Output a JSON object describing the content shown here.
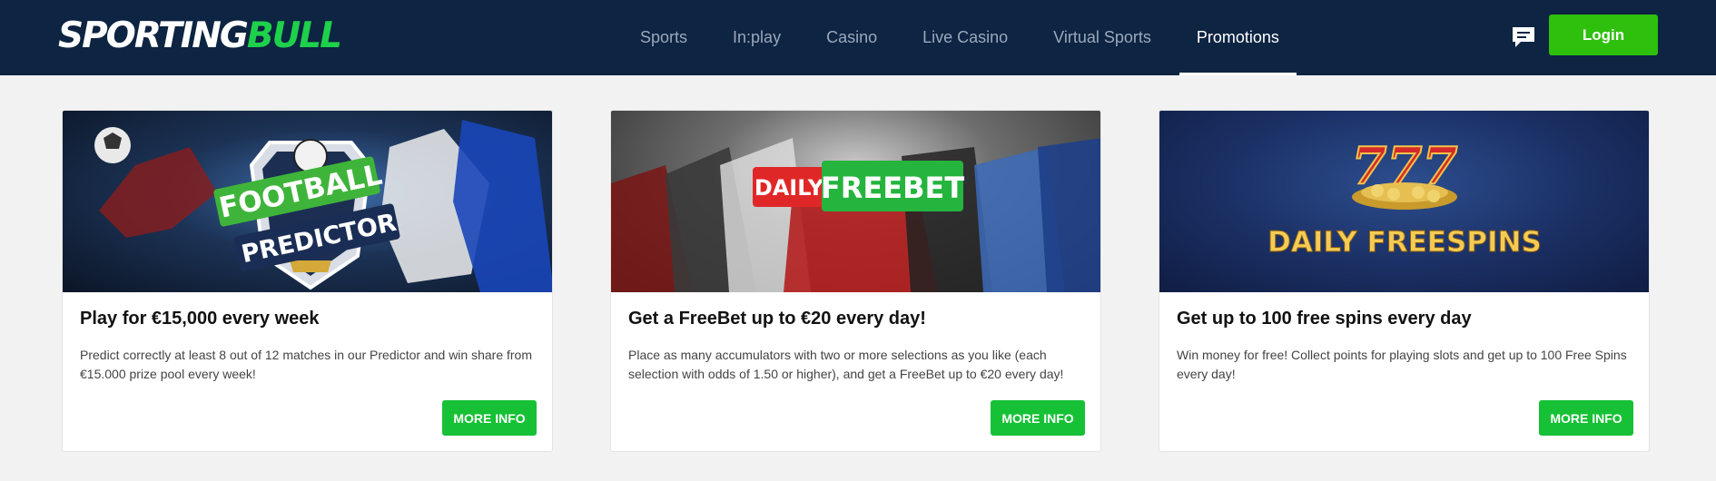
{
  "header": {
    "logo_part1": "SPORTING",
    "logo_part2": "BULL",
    "nav": [
      {
        "label": "Sports"
      },
      {
        "label": "In:play"
      },
      {
        "label": "Casino"
      },
      {
        "label": "Live Casino"
      },
      {
        "label": "Virtual Sports"
      },
      {
        "label": "Promotions",
        "active": true
      }
    ],
    "chat_icon": "chat-icon",
    "login_label": "Login"
  },
  "cards": [
    {
      "banner_line1": "FOOTBALL",
      "banner_line2": "PREDICTOR",
      "title": "Play for €15,000 every week",
      "description": "Predict correctly at least 8 out of 12 matches in our Predictor and win share from €15.000 prize pool every week!",
      "button": "MORE INFO"
    },
    {
      "banner_line1": "DAILY",
      "banner_line2": "FREEBET",
      "title": "Get a FreeBet up to €20 every day!",
      "description": "Place as many accumulators with two or more selections as you like (each selection with odds of 1.50 or higher), and get a FreeBet up to €20 every day!",
      "button": "MORE INFO"
    },
    {
      "banner_line1": "777",
      "banner_line2": "DAILY FREESPINS",
      "title": "Get up to 100 free spins every day",
      "description": "Win money for free! Collect points for playing slots and get up to 100 Free Spins every day!",
      "button": "MORE INFO"
    }
  ],
  "colors": {
    "header_bg": "#0d2442",
    "brand_green": "#1ed14b",
    "login_green": "#2fc00d",
    "button_green": "#16c135",
    "page_bg": "#f2f2f2"
  }
}
